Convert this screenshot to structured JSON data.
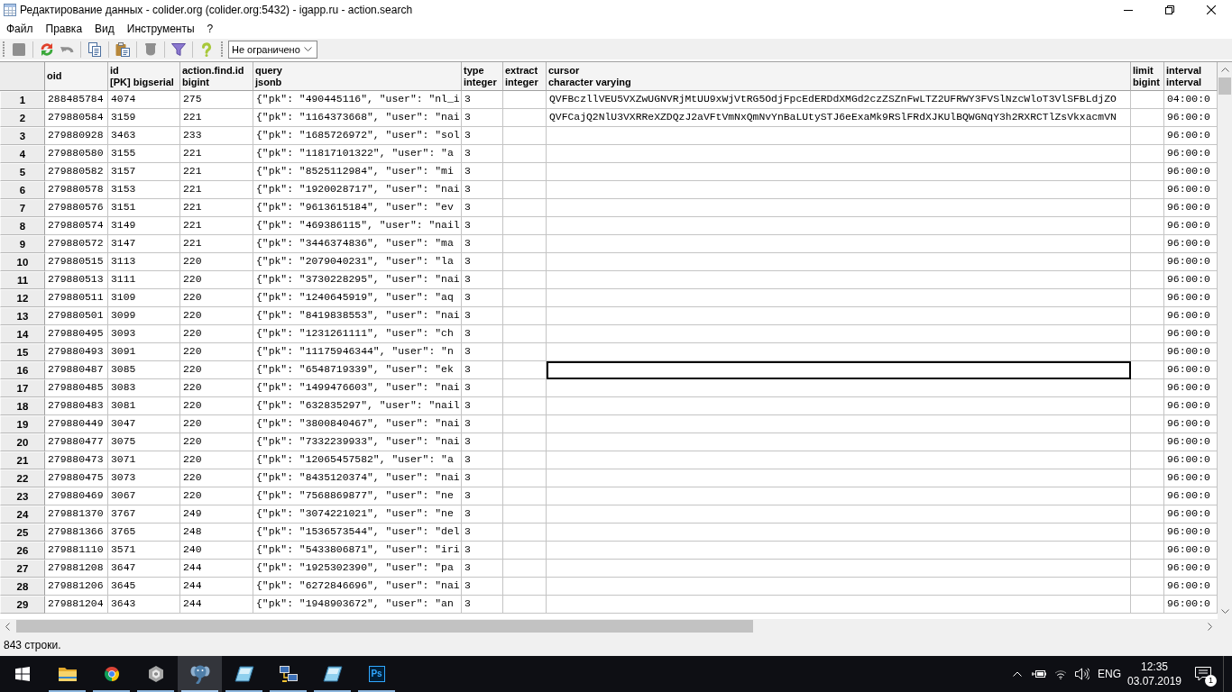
{
  "window": {
    "title": "Редактирование данных - colider.org (colider.org:5432) - igapp.ru - action.search"
  },
  "menu": [
    "Файл",
    "Правка",
    "Вид",
    "Инструменты",
    "?"
  ],
  "toolbar": {
    "groups": [
      {
        "buttons": [
          {
            "kind": "save",
            "disabled": true
          }
        ]
      },
      {
        "buttons": [
          {
            "kind": "refresh",
            "disabled": false
          },
          {
            "kind": "undo",
            "disabled": true
          }
        ]
      },
      {
        "buttons": [
          {
            "kind": "copy",
            "disabled": false
          }
        ]
      },
      {
        "buttons": [
          {
            "kind": "paste",
            "disabled": false
          }
        ]
      },
      {
        "buttons": [
          {
            "kind": "delete",
            "disabled": true
          }
        ]
      },
      {
        "buttons": [
          {
            "kind": "filter",
            "disabled": false
          }
        ]
      },
      {
        "buttons": [
          {
            "kind": "help",
            "disabled": false
          }
        ]
      }
    ],
    "row_limit": {
      "value": "Не ограничено"
    }
  },
  "table": {
    "columns": [
      {
        "name": "oid"
      },
      {
        "name": "id",
        "type": "[PK] bigserial"
      },
      {
        "name": "action.find.id",
        "type": "bigint"
      },
      {
        "name": "query",
        "type": "jsonb"
      },
      {
        "name": "type",
        "type": "integer"
      },
      {
        "name": "extract",
        "type": "integer"
      },
      {
        "name": "cursor",
        "type": "character varying"
      },
      {
        "name": "limit",
        "type": "bigint"
      },
      {
        "name": "interval",
        "type": "interval"
      }
    ],
    "rows": [
      {
        "number": "1",
        "cells": [
          {
            "text": "288485784",
            "selected": false
          },
          {
            "text": "4074",
            "selected": false
          },
          {
            "text": "275",
            "selected": false
          },
          {
            "text": "{\"pk\": \"490445116\", \"user\": \"nl_i",
            "selected": false
          },
          {
            "text": "3",
            "selected": false
          },
          {
            "selected": false
          },
          {
            "text": "QVFBczllVEU5VXZwUGNVRjMtUU9xWjVtRG5OdjFpcEdERDdXMGd2czZSZnFwLTZ2UFRWY3FVSlNzcWloT3VlSFBLdjZO",
            "selected": false
          },
          {
            "selected": false
          },
          {
            "text": "04:00:0",
            "selected": false
          }
        ]
      },
      {
        "number": "2",
        "cells": [
          {
            "text": "279880584",
            "selected": false
          },
          {
            "text": "3159",
            "selected": false
          },
          {
            "text": "221",
            "selected": false
          },
          {
            "text": "{\"pk\": \"1164373668\", \"user\": \"nai",
            "selected": false
          },
          {
            "text": "3",
            "selected": false
          },
          {
            "selected": false
          },
          {
            "text": "QVFCajQ2NlU3VXRReXZDQzJ2aVFtVmNxQmNvYnBaLUtySTJ6eExaMk9RSlFRdXJKUlBQWGNqY3h2RXRCTlZsVkxacmVN",
            "selected": false
          },
          {
            "selected": false
          },
          {
            "text": "96:00:0",
            "selected": false
          }
        ]
      },
      {
        "number": "3",
        "cells": [
          {
            "text": "279880928",
            "selected": false
          },
          {
            "text": "3463",
            "selected": false
          },
          {
            "text": "233",
            "selected": false
          },
          {
            "text": "{\"pk\": \"1685726972\", \"user\": \"sol",
            "selected": false
          },
          {
            "text": "3",
            "selected": false
          },
          {
            "selected": false
          },
          {
            "selected": false
          },
          {
            "selected": false
          },
          {
            "text": "96:00:0",
            "selected": false
          }
        ]
      },
      {
        "number": "4",
        "cells": [
          {
            "text": "279880580",
            "selected": false
          },
          {
            "text": "3155",
            "selected": false
          },
          {
            "text": "221",
            "selected": false
          },
          {
            "text": "{\"pk\": \"11817101322\", \"user\": \"a",
            "selected": false
          },
          {
            "text": "3",
            "selected": false
          },
          {
            "selected": false
          },
          {
            "selected": false
          },
          {
            "selected": false
          },
          {
            "text": "96:00:0",
            "selected": false
          }
        ]
      },
      {
        "number": "5",
        "cells": [
          {
            "text": "279880582",
            "selected": false
          },
          {
            "text": "3157",
            "selected": false
          },
          {
            "text": "221",
            "selected": false
          },
          {
            "text": "{\"pk\": \"8525112984\", \"user\": \"mi",
            "selected": false
          },
          {
            "text": "3",
            "selected": false
          },
          {
            "selected": false
          },
          {
            "selected": false
          },
          {
            "selected": false
          },
          {
            "text": "96:00:0",
            "selected": false
          }
        ]
      },
      {
        "number": "6",
        "cells": [
          {
            "text": "279880578",
            "selected": false
          },
          {
            "text": "3153",
            "selected": false
          },
          {
            "text": "221",
            "selected": false
          },
          {
            "text": "{\"pk\": \"1920028717\", \"user\": \"nai",
            "selected": false
          },
          {
            "text": "3",
            "selected": false
          },
          {
            "selected": false
          },
          {
            "selected": false
          },
          {
            "selected": false
          },
          {
            "text": "96:00:0",
            "selected": false
          }
        ]
      },
      {
        "number": "7",
        "cells": [
          {
            "text": "279880576",
            "selected": false
          },
          {
            "text": "3151",
            "selected": false
          },
          {
            "text": "221",
            "selected": false
          },
          {
            "text": "{\"pk\": \"9613615184\", \"user\": \"ev",
            "selected": false
          },
          {
            "text": "3",
            "selected": false
          },
          {
            "selected": false
          },
          {
            "selected": false
          },
          {
            "selected": false
          },
          {
            "text": "96:00:0",
            "selected": false
          }
        ]
      },
      {
        "number": "8",
        "cells": [
          {
            "text": "279880574",
            "selected": false
          },
          {
            "text": "3149",
            "selected": false
          },
          {
            "text": "221",
            "selected": false
          },
          {
            "text": "{\"pk\": \"469386115\", \"user\": \"nail",
            "selected": false
          },
          {
            "text": "3",
            "selected": false
          },
          {
            "selected": false
          },
          {
            "selected": false
          },
          {
            "selected": false
          },
          {
            "text": "96:00:0",
            "selected": false
          }
        ]
      },
      {
        "number": "9",
        "cells": [
          {
            "text": "279880572",
            "selected": false
          },
          {
            "text": "3147",
            "selected": false
          },
          {
            "text": "221",
            "selected": false
          },
          {
            "text": "{\"pk\": \"3446374836\", \"user\": \"ma",
            "selected": false
          },
          {
            "text": "3",
            "selected": false
          },
          {
            "selected": false
          },
          {
            "selected": false
          },
          {
            "selected": false
          },
          {
            "text": "96:00:0",
            "selected": false
          }
        ]
      },
      {
        "number": "10",
        "cells": [
          {
            "text": "279880515",
            "selected": false
          },
          {
            "text": "3113",
            "selected": false
          },
          {
            "text": "220",
            "selected": false
          },
          {
            "text": "{\"pk\": \"2079040231\", \"user\": \"la",
            "selected": false
          },
          {
            "text": "3",
            "selected": false
          },
          {
            "selected": false
          },
          {
            "selected": false
          },
          {
            "selected": false
          },
          {
            "text": "96:00:0",
            "selected": false
          }
        ]
      },
      {
        "number": "11",
        "cells": [
          {
            "text": "279880513",
            "selected": false
          },
          {
            "text": "3111",
            "selected": false
          },
          {
            "text": "220",
            "selected": false
          },
          {
            "text": "{\"pk\": \"3730228295\", \"user\": \"nai",
            "selected": false
          },
          {
            "text": "3",
            "selected": false
          },
          {
            "selected": false
          },
          {
            "selected": false
          },
          {
            "selected": false
          },
          {
            "text": "96:00:0",
            "selected": false
          }
        ]
      },
      {
        "number": "12",
        "cells": [
          {
            "text": "279880511",
            "selected": false
          },
          {
            "text": "3109",
            "selected": false
          },
          {
            "text": "220",
            "selected": false
          },
          {
            "text": "{\"pk\": \"1240645919\", \"user\": \"aq",
            "selected": false
          },
          {
            "text": "3",
            "selected": false
          },
          {
            "selected": false
          },
          {
            "selected": false
          },
          {
            "selected": false
          },
          {
            "text": "96:00:0",
            "selected": false
          }
        ]
      },
      {
        "number": "13",
        "cells": [
          {
            "text": "279880501",
            "selected": false
          },
          {
            "text": "3099",
            "selected": false
          },
          {
            "text": "220",
            "selected": false
          },
          {
            "text": "{\"pk\": \"8419838553\", \"user\": \"nai",
            "selected": false
          },
          {
            "text": "3",
            "selected": false
          },
          {
            "selected": false
          },
          {
            "selected": false
          },
          {
            "selected": false
          },
          {
            "text": "96:00:0",
            "selected": false
          }
        ]
      },
      {
        "number": "14",
        "cells": [
          {
            "text": "279880495",
            "selected": false
          },
          {
            "text": "3093",
            "selected": false
          },
          {
            "text": "220",
            "selected": false
          },
          {
            "text": "{\"pk\": \"1231261111\", \"user\": \"ch",
            "selected": false
          },
          {
            "text": "3",
            "selected": false
          },
          {
            "selected": false
          },
          {
            "selected": false
          },
          {
            "selected": false
          },
          {
            "text": "96:00:0",
            "selected": false
          }
        ]
      },
      {
        "number": "15",
        "cells": [
          {
            "text": "279880493",
            "selected": false
          },
          {
            "text": "3091",
            "selected": false
          },
          {
            "text": "220",
            "selected": false
          },
          {
            "text": "{\"pk\": \"11175946344\", \"user\": \"n",
            "selected": false
          },
          {
            "text": "3",
            "selected": false
          },
          {
            "selected": false
          },
          {
            "selected": false
          },
          {
            "selected": false
          },
          {
            "text": "96:00:0",
            "selected": false
          }
        ]
      },
      {
        "number": "16",
        "cells": [
          {
            "text": "279880487",
            "selected": false
          },
          {
            "text": "3085",
            "selected": false
          },
          {
            "text": "220",
            "selected": false
          },
          {
            "text": "{\"pk\": \"6548719339\", \"user\": \"ek",
            "selected": false
          },
          {
            "text": "3",
            "selected": false
          },
          {
            "selected": false
          },
          {
            "selected": true
          },
          {
            "selected": false
          },
          {
            "text": "96:00:0",
            "selected": false
          }
        ]
      },
      {
        "number": "17",
        "cells": [
          {
            "text": "279880485",
            "selected": false
          },
          {
            "text": "3083",
            "selected": false
          },
          {
            "text": "220",
            "selected": false
          },
          {
            "text": "{\"pk\": \"1499476603\", \"user\": \"nai",
            "selected": false
          },
          {
            "text": "3",
            "selected": false
          },
          {
            "selected": false
          },
          {
            "selected": false
          },
          {
            "selected": false
          },
          {
            "text": "96:00:0",
            "selected": false
          }
        ]
      },
      {
        "number": "18",
        "cells": [
          {
            "text": "279880483",
            "selected": false
          },
          {
            "text": "3081",
            "selected": false
          },
          {
            "text": "220",
            "selected": false
          },
          {
            "text": "{\"pk\": \"632835297\", \"user\": \"nail",
            "selected": false
          },
          {
            "text": "3",
            "selected": false
          },
          {
            "selected": false
          },
          {
            "selected": false
          },
          {
            "selected": false
          },
          {
            "text": "96:00:0",
            "selected": false
          }
        ]
      },
      {
        "number": "19",
        "cells": [
          {
            "text": "279880449",
            "selected": false
          },
          {
            "text": "3047",
            "selected": false
          },
          {
            "text": "220",
            "selected": false
          },
          {
            "text": "{\"pk\": \"3800840467\", \"user\": \"nai",
            "selected": false
          },
          {
            "text": "3",
            "selected": false
          },
          {
            "selected": false
          },
          {
            "selected": false
          },
          {
            "selected": false
          },
          {
            "text": "96:00:0",
            "selected": false
          }
        ]
      },
      {
        "number": "20",
        "cells": [
          {
            "text": "279880477",
            "selected": false
          },
          {
            "text": "3075",
            "selected": false
          },
          {
            "text": "220",
            "selected": false
          },
          {
            "text": "{\"pk\": \"7332239933\", \"user\": \"nai",
            "selected": false
          },
          {
            "text": "3",
            "selected": false
          },
          {
            "selected": false
          },
          {
            "selected": false
          },
          {
            "selected": false
          },
          {
            "text": "96:00:0",
            "selected": false
          }
        ]
      },
      {
        "number": "21",
        "cells": [
          {
            "text": "279880473",
            "selected": false
          },
          {
            "text": "3071",
            "selected": false
          },
          {
            "text": "220",
            "selected": false
          },
          {
            "text": "{\"pk\": \"12065457582\", \"user\": \"a",
            "selected": false
          },
          {
            "text": "3",
            "selected": false
          },
          {
            "selected": false
          },
          {
            "selected": false
          },
          {
            "selected": false
          },
          {
            "text": "96:00:0",
            "selected": false
          }
        ]
      },
      {
        "number": "22",
        "cells": [
          {
            "text": "279880475",
            "selected": false
          },
          {
            "text": "3073",
            "selected": false
          },
          {
            "text": "220",
            "selected": false
          },
          {
            "text": "{\"pk\": \"8435120374\", \"user\": \"nai",
            "selected": false
          },
          {
            "text": "3",
            "selected": false
          },
          {
            "selected": false
          },
          {
            "selected": false
          },
          {
            "selected": false
          },
          {
            "text": "96:00:0",
            "selected": false
          }
        ]
      },
      {
        "number": "23",
        "cells": [
          {
            "text": "279880469",
            "selected": false
          },
          {
            "text": "3067",
            "selected": false
          },
          {
            "text": "220",
            "selected": false
          },
          {
            "text": "{\"pk\": \"7568869877\", \"user\": \"ne",
            "selected": false
          },
          {
            "text": "3",
            "selected": false
          },
          {
            "selected": false
          },
          {
            "selected": false
          },
          {
            "selected": false
          },
          {
            "text": "96:00:0",
            "selected": false
          }
        ]
      },
      {
        "number": "24",
        "cells": [
          {
            "text": "279881370",
            "selected": false
          },
          {
            "text": "3767",
            "selected": false
          },
          {
            "text": "249",
            "selected": false
          },
          {
            "text": "{\"pk\": \"3074221021\", \"user\": \"ne",
            "selected": false
          },
          {
            "text": "3",
            "selected": false
          },
          {
            "selected": false
          },
          {
            "selected": false
          },
          {
            "selected": false
          },
          {
            "text": "96:00:0",
            "selected": false
          }
        ]
      },
      {
        "number": "25",
        "cells": [
          {
            "text": "279881366",
            "selected": false
          },
          {
            "text": "3765",
            "selected": false
          },
          {
            "text": "248",
            "selected": false
          },
          {
            "text": "{\"pk\": \"1536573544\", \"user\": \"del",
            "selected": false
          },
          {
            "text": "3",
            "selected": false
          },
          {
            "selected": false
          },
          {
            "selected": false
          },
          {
            "selected": false
          },
          {
            "text": "96:00:0",
            "selected": false
          }
        ]
      },
      {
        "number": "26",
        "cells": [
          {
            "text": "279881110",
            "selected": false
          },
          {
            "text": "3571",
            "selected": false
          },
          {
            "text": "240",
            "selected": false
          },
          {
            "text": "{\"pk\": \"5433806871\", \"user\": \"iri",
            "selected": false
          },
          {
            "text": "3",
            "selected": false
          },
          {
            "selected": false
          },
          {
            "selected": false
          },
          {
            "selected": false
          },
          {
            "text": "96:00:0",
            "selected": false
          }
        ]
      },
      {
        "number": "27",
        "cells": [
          {
            "text": "279881208",
            "selected": false
          },
          {
            "text": "3647",
            "selected": false
          },
          {
            "text": "244",
            "selected": false
          },
          {
            "text": "{\"pk\": \"1925302390\", \"user\": \"pa",
            "selected": false
          },
          {
            "text": "3",
            "selected": false
          },
          {
            "selected": false
          },
          {
            "selected": false
          },
          {
            "selected": false
          },
          {
            "text": "96:00:0",
            "selected": false
          }
        ]
      },
      {
        "number": "28",
        "cells": [
          {
            "text": "279881206",
            "selected": false
          },
          {
            "text": "3645",
            "selected": false
          },
          {
            "text": "244",
            "selected": false
          },
          {
            "text": "{\"pk\": \"6272846696\", \"user\": \"nai",
            "selected": false
          },
          {
            "text": "3",
            "selected": false
          },
          {
            "selected": false
          },
          {
            "selected": false
          },
          {
            "selected": false
          },
          {
            "text": "96:00:0",
            "selected": false
          }
        ]
      },
      {
        "number": "29",
        "cells": [
          {
            "text": "279881204",
            "selected": false
          },
          {
            "text": "3643",
            "selected": false
          },
          {
            "text": "244",
            "selected": false
          },
          {
            "text": "{\"pk\": \"1948903672\", \"user\": \"an",
            "selected": false
          },
          {
            "text": "3",
            "selected": false
          },
          {
            "selected": false
          },
          {
            "selected": false
          },
          {
            "selected": false
          },
          {
            "text": "96:00:0",
            "selected": false
          }
        ]
      }
    ]
  },
  "status_bar": {
    "text": "843 строки."
  },
  "taskbar": {
    "apps": [
      {
        "kind": "folder",
        "running": true,
        "active": false
      },
      {
        "kind": "circle",
        "running": true,
        "active": false
      },
      {
        "kind": "hexagon",
        "running": true,
        "active": false
      },
      {
        "kind": "elephant",
        "running": true,
        "active": true
      },
      {
        "kind": "pane",
        "running": true,
        "active": false
      },
      {
        "kind": "network",
        "running": true,
        "active": false
      },
      {
        "kind": "pane",
        "running": true,
        "active": false
      },
      {
        "kind": "tile",
        "label": "Ps",
        "running": true,
        "active": false
      }
    ],
    "tray": {
      "language": "ENG",
      "time": "12:35",
      "date": "03.07.2019",
      "notifications": "1"
    }
  }
}
